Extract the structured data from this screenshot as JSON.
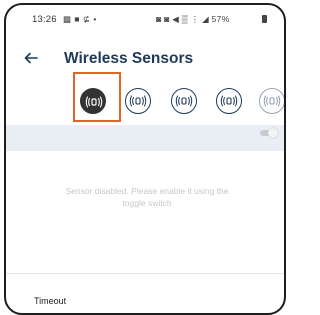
{
  "status_bar": {
    "time": "13:26",
    "notification_icons": "▩ ■ ⊈  •",
    "system_icons": "◙ ◙ ◀ ▒ ⋮ ◢ 57%"
  },
  "app_bar": {
    "title": "Wireless Sensors",
    "back_icon": "arrow-left-icon"
  },
  "sensor_tabs": [
    {
      "icon": "wireless-sensor-icon",
      "state": "active"
    },
    {
      "icon": "wireless-sensor-icon",
      "state": "normal"
    },
    {
      "icon": "wireless-sensor-icon",
      "state": "normal"
    },
    {
      "icon": "wireless-sensor-icon",
      "state": "normal"
    },
    {
      "icon": "wireless-sensor-icon",
      "state": "faded"
    }
  ],
  "toggle": {
    "enabled": false
  },
  "empty_state": {
    "message": "Sensor disabled. Please enable it using the toggle switch"
  },
  "settings": {
    "timeout_label": "Timeout"
  },
  "colors": {
    "accent_dark": "#1f3a5a",
    "highlight": "#e0672a",
    "subbar": "#e9edf4"
  }
}
